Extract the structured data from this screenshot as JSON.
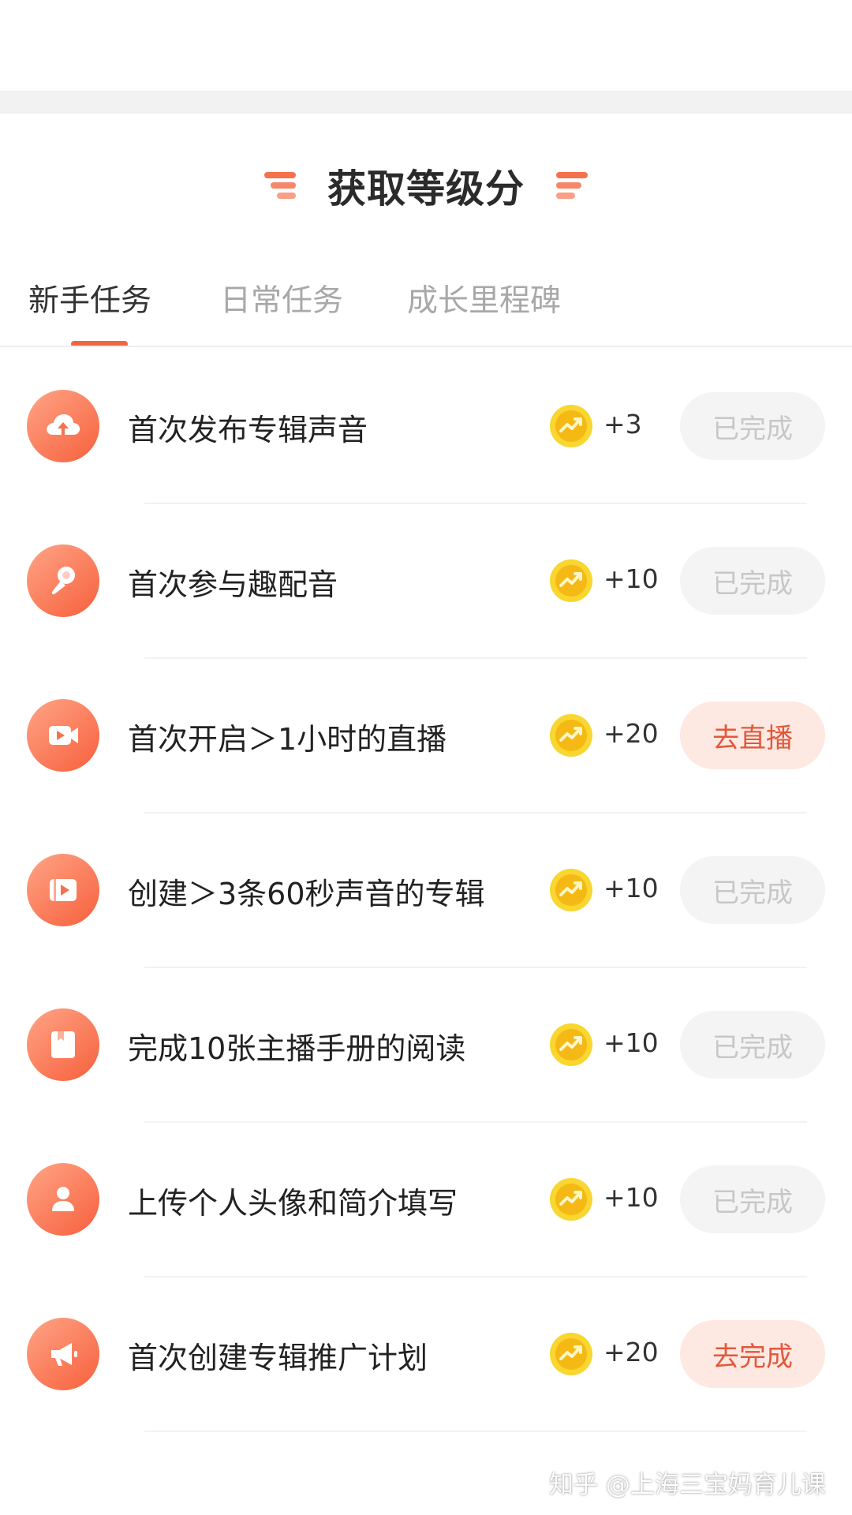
{
  "header": {
    "title": "获取等级分"
  },
  "tabs": [
    {
      "label": "新手任务",
      "active": true
    },
    {
      "label": "日常任务",
      "active": false
    },
    {
      "label": "成长里程碑",
      "active": false
    }
  ],
  "tasks": [
    {
      "icon": "cloud-upload-icon",
      "label": "首次发布专辑声音",
      "points": "+3",
      "action": "已完成",
      "state": "done"
    },
    {
      "icon": "microphone-icon",
      "label": "首次参与趣配音",
      "points": "+10",
      "action": "已完成",
      "state": "done"
    },
    {
      "icon": "video-camera-icon",
      "label": "首次开启＞1小时的直播",
      "points": "+20",
      "action": "去直播",
      "state": "todo"
    },
    {
      "icon": "video-album-icon",
      "label": "创建＞3条60秒声音的专辑",
      "points": "+10",
      "action": "已完成",
      "state": "done"
    },
    {
      "icon": "handbook-icon",
      "label": "完成10张主播手册的阅读",
      "points": "+10",
      "action": "已完成",
      "state": "done"
    },
    {
      "icon": "user-profile-icon",
      "label": "上传个人头像和简介填写",
      "points": "+10",
      "action": "已完成",
      "state": "done"
    },
    {
      "icon": "megaphone-icon",
      "label": "首次创建专辑推广计划",
      "points": "+20",
      "action": "去完成",
      "state": "todo"
    }
  ],
  "watermark": "知乎 @上海三宝妈育儿课",
  "colors": {
    "accent": "#f0673f",
    "done_bg": "#f4f4f5",
    "done_text": "#c7c7c9",
    "go_bg": "#fde8e2",
    "go_text": "#e2583a",
    "coin": "#f7c51e"
  }
}
